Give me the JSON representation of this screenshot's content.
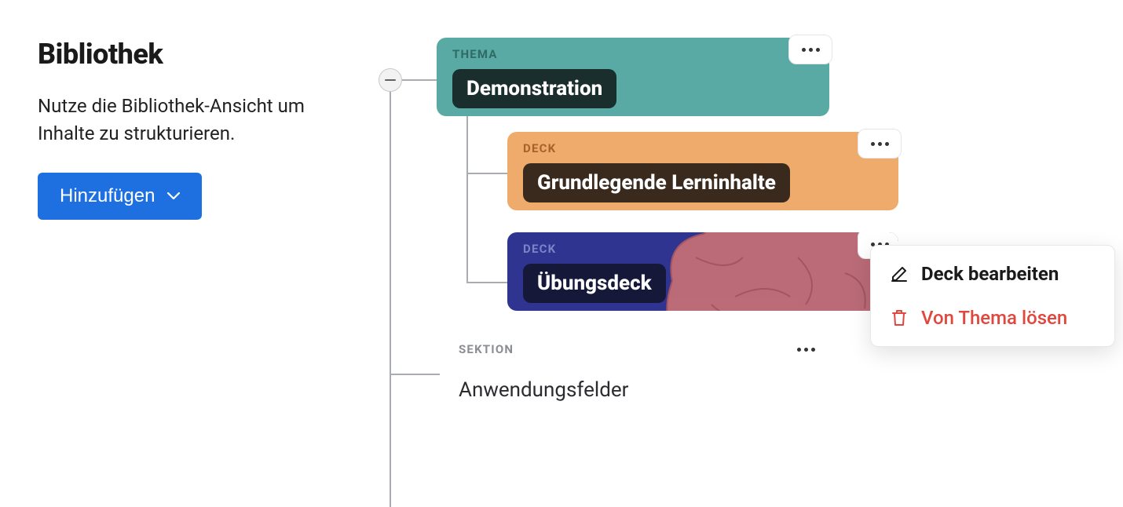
{
  "header": {
    "title": "Bibliothek",
    "description": "Nutze die Bibliothek-Ansicht um Inhalte zu strukturieren.",
    "add_button_label": "Hinzufügen"
  },
  "tree": {
    "thema": {
      "tag": "THEMA",
      "title": "Demonstration"
    },
    "decks": [
      {
        "tag": "DECK",
        "title": "Grundlegende Lerninhalte"
      },
      {
        "tag": "DECK",
        "title": "Übungsdeck"
      }
    ],
    "section": {
      "tag": "SEKTION",
      "title": "Anwendungsfelder"
    }
  },
  "context_menu": {
    "edit_label": "Deck bearbeiten",
    "detach_label": "Von Thema lösen"
  }
}
